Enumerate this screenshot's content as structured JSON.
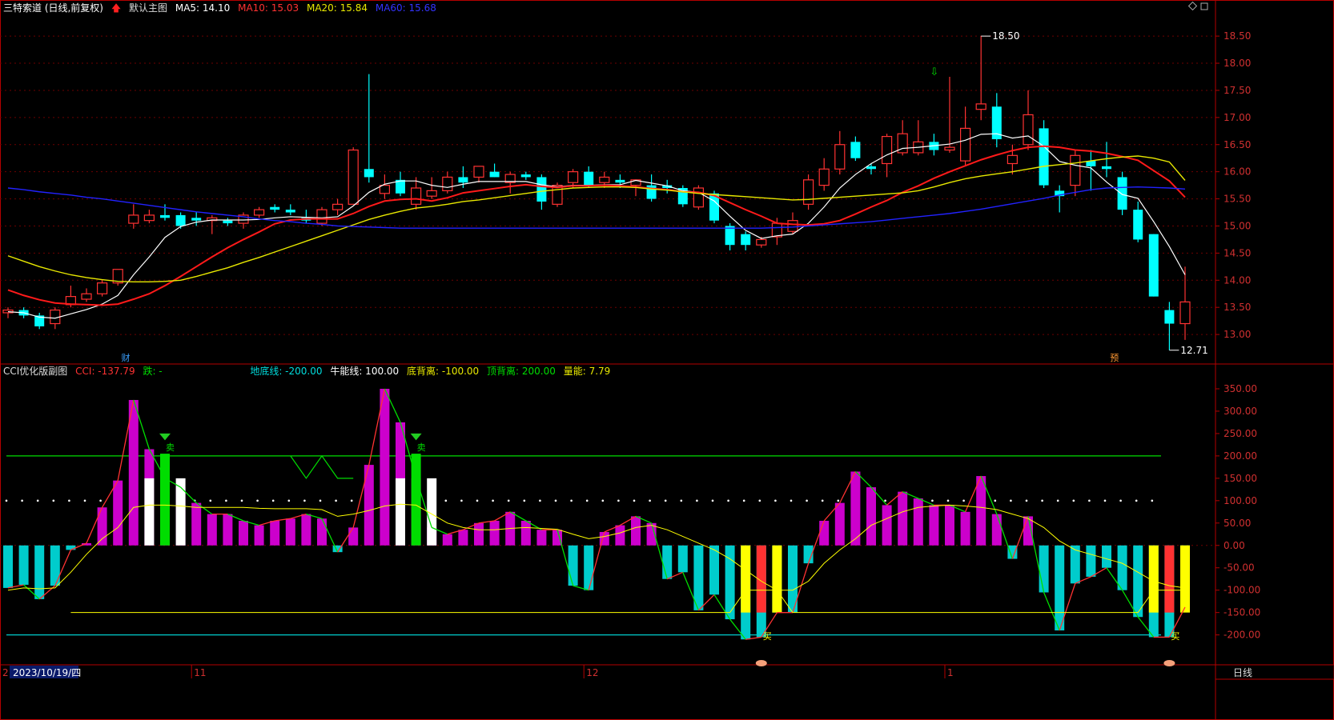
{
  "colors": {
    "up": "#ff3232",
    "down": "#00ffff",
    "ma5": "#ffffff",
    "ma10": "#ff1a1a",
    "ma20": "#e8e800",
    "ma60": "#2222ff",
    "axis": "#b40000",
    "grid": "#6e0000",
    "cci_pos": "#cc00cc",
    "cci_neg": "#00cccc",
    "green": "#00dd00",
    "yellow": "#ffff00",
    "white": "#ffffff"
  },
  "header_main": {
    "title": "三特索道 (日线,前复权)",
    "arrow_icon": "up-arrow-icon",
    "template": "默认主图",
    "ma5": "MA5: 14.10",
    "ma10": "MA10: 15.03",
    "ma20": "MA20: 15.84",
    "ma60": "MA60: 15.68"
  },
  "header_sub": {
    "title": "CCI优化版副图",
    "cci": "CCI: -137.79",
    "fall": "跌: -",
    "dd": "地底线: -200.00",
    "nn": "牛能线: 100.00",
    "dbl": "底背离: -100.00",
    "dgl": "顶背离: 200.00",
    "ln": "量能: 7.79"
  },
  "footer": {
    "date": "2023/10/19/四",
    "months": [
      {
        "label": "11",
        "i": 12
      },
      {
        "label": "12",
        "i": 37
      },
      {
        "label": "1",
        "i": 60
      },
      {
        "label": "2",
        "i": 84
      }
    ],
    "period_label": "日线"
  },
  "markers": {
    "cai": "财",
    "yu": "预",
    "sell": "卖",
    "buy": "买",
    "high_label": "18.50",
    "low_label": "12.71"
  },
  "chart_data": [
    {
      "type": "candlestick",
      "title": "三特索道 (日线,前复权)",
      "ylim": [
        12.5,
        18.9
      ],
      "y_ticks": [
        13.0,
        13.5,
        14.0,
        14.5,
        15.0,
        15.5,
        16.0,
        16.5,
        17.0,
        17.5,
        18.0,
        18.5
      ],
      "candles": [
        {
          "o": 13.4,
          "h": 13.5,
          "l": 13.3,
          "c": 13.45
        },
        {
          "o": 13.45,
          "h": 13.5,
          "l": 13.3,
          "c": 13.35
        },
        {
          "o": 13.35,
          "h": 13.4,
          "l": 13.1,
          "c": 13.15
        },
        {
          "o": 13.2,
          "h": 13.5,
          "l": 13.1,
          "c": 13.45
        },
        {
          "o": 13.55,
          "h": 13.9,
          "l": 13.5,
          "c": 13.7
        },
        {
          "o": 13.65,
          "h": 13.85,
          "l": 13.6,
          "c": 13.75
        },
        {
          "o": 13.75,
          "h": 14.0,
          "l": 13.7,
          "c": 13.95
        },
        {
          "o": 13.95,
          "h": 14.2,
          "l": 13.9,
          "c": 14.2
        },
        {
          "o": 15.05,
          "h": 15.4,
          "l": 14.95,
          "c": 15.2
        },
        {
          "o": 15.1,
          "h": 15.3,
          "l": 15.05,
          "c": 15.2
        },
        {
          "o": 15.2,
          "h": 15.4,
          "l": 15.1,
          "c": 15.15
        },
        {
          "o": 15.2,
          "h": 15.25,
          "l": 14.95,
          "c": 15.0
        },
        {
          "o": 15.15,
          "h": 15.25,
          "l": 15.0,
          "c": 15.1
        },
        {
          "o": 15.1,
          "h": 15.2,
          "l": 14.85,
          "c": 15.15
        },
        {
          "o": 15.1,
          "h": 15.15,
          "l": 15.0,
          "c": 15.05
        },
        {
          "o": 15.05,
          "h": 15.25,
          "l": 14.95,
          "c": 15.2
        },
        {
          "o": 15.2,
          "h": 15.35,
          "l": 15.15,
          "c": 15.3
        },
        {
          "o": 15.35,
          "h": 15.4,
          "l": 15.25,
          "c": 15.3
        },
        {
          "o": 15.3,
          "h": 15.4,
          "l": 15.2,
          "c": 15.25
        },
        {
          "o": 15.15,
          "h": 15.3,
          "l": 15.05,
          "c": 15.1
        },
        {
          "o": 15.05,
          "h": 15.35,
          "l": 15.0,
          "c": 15.3
        },
        {
          "o": 15.3,
          "h": 15.5,
          "l": 15.2,
          "c": 15.4
        },
        {
          "o": 15.4,
          "h": 16.45,
          "l": 15.4,
          "c": 16.4
        },
        {
          "o": 16.05,
          "h": 17.8,
          "l": 15.8,
          "c": 15.9
        },
        {
          "o": 15.6,
          "h": 15.95,
          "l": 15.5,
          "c": 15.75
        },
        {
          "o": 15.85,
          "h": 16.0,
          "l": 15.55,
          "c": 15.6
        },
        {
          "o": 15.4,
          "h": 15.9,
          "l": 15.3,
          "c": 15.7
        },
        {
          "o": 15.55,
          "h": 15.9,
          "l": 15.5,
          "c": 15.65
        },
        {
          "o": 15.65,
          "h": 16.0,
          "l": 15.6,
          "c": 15.9
        },
        {
          "o": 15.9,
          "h": 16.1,
          "l": 15.7,
          "c": 15.8
        },
        {
          "o": 15.9,
          "h": 16.1,
          "l": 15.8,
          "c": 16.1
        },
        {
          "o": 16.0,
          "h": 16.15,
          "l": 15.9,
          "c": 15.9
        },
        {
          "o": 15.8,
          "h": 16.0,
          "l": 15.6,
          "c": 15.95
        },
        {
          "o": 15.95,
          "h": 16.0,
          "l": 15.85,
          "c": 15.9
        },
        {
          "o": 15.9,
          "h": 15.95,
          "l": 15.3,
          "c": 15.45
        },
        {
          "o": 15.4,
          "h": 15.8,
          "l": 15.35,
          "c": 15.75
        },
        {
          "o": 15.8,
          "h": 16.05,
          "l": 15.7,
          "c": 16.0
        },
        {
          "o": 16.0,
          "h": 16.1,
          "l": 15.7,
          "c": 15.75
        },
        {
          "o": 15.8,
          "h": 16.0,
          "l": 15.7,
          "c": 15.9
        },
        {
          "o": 15.85,
          "h": 15.95,
          "l": 15.7,
          "c": 15.8
        },
        {
          "o": 15.75,
          "h": 15.85,
          "l": 15.55,
          "c": 15.85
        },
        {
          "o": 15.75,
          "h": 15.95,
          "l": 15.45,
          "c": 15.5
        },
        {
          "o": 15.75,
          "h": 15.85,
          "l": 15.6,
          "c": 15.7
        },
        {
          "o": 15.7,
          "h": 15.75,
          "l": 15.35,
          "c": 15.4
        },
        {
          "o": 15.35,
          "h": 15.75,
          "l": 15.3,
          "c": 15.7
        },
        {
          "o": 15.6,
          "h": 15.65,
          "l": 15.05,
          "c": 15.1
        },
        {
          "o": 15.0,
          "h": 15.05,
          "l": 14.55,
          "c": 14.65
        },
        {
          "o": 14.85,
          "h": 14.9,
          "l": 14.55,
          "c": 14.65
        },
        {
          "o": 14.65,
          "h": 14.8,
          "l": 14.6,
          "c": 14.75
        },
        {
          "o": 14.8,
          "h": 15.15,
          "l": 14.65,
          "c": 15.05
        },
        {
          "o": 14.9,
          "h": 15.25,
          "l": 14.85,
          "c": 15.1
        },
        {
          "o": 15.4,
          "h": 15.95,
          "l": 15.3,
          "c": 15.85
        },
        {
          "o": 15.75,
          "h": 16.25,
          "l": 15.65,
          "c": 16.05
        },
        {
          "o": 16.05,
          "h": 16.75,
          "l": 15.95,
          "c": 16.5
        },
        {
          "o": 16.55,
          "h": 16.65,
          "l": 16.2,
          "c": 16.25
        },
        {
          "o": 16.1,
          "h": 16.15,
          "l": 15.95,
          "c": 16.05
        },
        {
          "o": 16.15,
          "h": 16.7,
          "l": 15.9,
          "c": 16.65
        },
        {
          "o": 16.35,
          "h": 16.95,
          "l": 16.3,
          "c": 16.7
        },
        {
          "o": 16.35,
          "h": 16.95,
          "l": 16.3,
          "c": 16.55
        },
        {
          "o": 16.55,
          "h": 16.7,
          "l": 16.3,
          "c": 16.4
        },
        {
          "o": 16.4,
          "h": 17.75,
          "l": 16.35,
          "c": 16.45
        },
        {
          "o": 16.2,
          "h": 17.2,
          "l": 16.1,
          "c": 16.8
        },
        {
          "o": 17.15,
          "h": 18.5,
          "l": 16.95,
          "c": 17.25
        },
        {
          "o": 17.2,
          "h": 17.45,
          "l": 16.45,
          "c": 16.6
        },
        {
          "o": 16.15,
          "h": 16.5,
          "l": 15.95,
          "c": 16.3
        },
        {
          "o": 16.5,
          "h": 17.5,
          "l": 16.4,
          "c": 17.05
        },
        {
          "o": 16.8,
          "h": 16.95,
          "l": 15.7,
          "c": 15.75
        },
        {
          "o": 15.65,
          "h": 15.75,
          "l": 15.25,
          "c": 15.55
        },
        {
          "o": 15.75,
          "h": 16.4,
          "l": 15.55,
          "c": 16.3
        },
        {
          "o": 16.2,
          "h": 16.4,
          "l": 15.65,
          "c": 16.1
        },
        {
          "o": 16.1,
          "h": 16.55,
          "l": 15.9,
          "c": 16.05
        },
        {
          "o": 15.9,
          "h": 16.0,
          "l": 15.2,
          "c": 15.3
        },
        {
          "o": 15.3,
          "h": 15.45,
          "l": 14.7,
          "c": 14.75
        },
        {
          "o": 14.85,
          "h": 14.85,
          "l": 13.7,
          "c": 13.7
        },
        {
          "o": 13.45,
          "h": 13.6,
          "l": 12.71,
          "c": 13.2
        },
        {
          "o": 13.2,
          "h": 14.25,
          "l": 12.9,
          "c": 13.6
        }
      ],
      "series": [
        {
          "name": "MA5",
          "values": [
            13.42,
            13.4,
            13.32,
            13.3,
            13.38,
            13.46,
            13.56,
            13.72,
            14.1,
            14.43,
            14.79,
            14.99,
            15.07,
            15.11,
            15.11,
            15.11,
            15.12,
            15.15,
            15.17,
            15.16,
            15.15,
            15.17,
            15.37,
            15.62,
            15.77,
            15.83,
            15.83,
            15.75,
            15.71,
            15.77,
            15.82,
            15.82,
            15.82,
            15.82,
            15.76,
            15.72,
            15.75,
            15.75,
            15.76,
            15.76,
            15.84,
            15.79,
            15.74,
            15.65,
            15.62,
            15.46,
            15.18,
            14.92,
            14.77,
            14.82,
            14.85,
            15.05,
            15.35,
            15.7,
            15.95,
            16.15,
            16.31,
            16.43,
            16.45,
            16.48,
            16.51,
            16.58,
            16.69,
            16.7,
            16.62,
            16.66,
            16.47,
            16.19,
            16.12,
            16.07,
            15.81,
            15.58,
            15.51,
            15.08,
            14.62,
            14.1
          ]
        },
        {
          "name": "MA10",
          "values": [
            13.82,
            13.72,
            13.64,
            13.58,
            13.56,
            13.55,
            13.54,
            13.56,
            13.65,
            13.75,
            13.9,
            14.07,
            14.25,
            14.43,
            14.6,
            14.75,
            14.89,
            15.04,
            15.11,
            15.13,
            15.13,
            15.13,
            15.23,
            15.36,
            15.46,
            15.49,
            15.5,
            15.46,
            15.52,
            15.61,
            15.65,
            15.69,
            15.73,
            15.76,
            15.73,
            15.71,
            15.74,
            15.74,
            15.75,
            15.74,
            15.72,
            15.69,
            15.67,
            15.63,
            15.62,
            15.56,
            15.43,
            15.3,
            15.18,
            15.05,
            15.03,
            15.02,
            15.04,
            15.1,
            15.22,
            15.35,
            15.47,
            15.62,
            15.74,
            15.88,
            16.0,
            16.11,
            16.22,
            16.31,
            16.39,
            16.45,
            16.47,
            16.45,
            16.4,
            16.38,
            16.34,
            16.28,
            16.21,
            16.02,
            15.83,
            15.53
          ]
        },
        {
          "name": "MA20",
          "values": [
            14.45,
            14.35,
            14.25,
            14.17,
            14.1,
            14.05,
            14.01,
            13.98,
            13.97,
            13.97,
            13.98,
            14.0,
            14.07,
            14.15,
            14.23,
            14.33,
            14.42,
            14.52,
            14.62,
            14.72,
            14.82,
            14.92,
            15.02,
            15.12,
            15.2,
            15.27,
            15.33,
            15.36,
            15.4,
            15.45,
            15.48,
            15.52,
            15.56,
            15.6,
            15.64,
            15.67,
            15.7,
            15.71,
            15.72,
            15.72,
            15.71,
            15.68,
            15.66,
            15.63,
            15.6,
            15.58,
            15.56,
            15.54,
            15.52,
            15.5,
            15.48,
            15.49,
            15.51,
            15.53,
            15.55,
            15.57,
            15.59,
            15.61,
            15.65,
            15.72,
            15.8,
            15.87,
            15.92,
            15.96,
            16.0,
            16.05,
            16.1,
            16.13,
            16.16,
            16.2,
            16.24,
            16.27,
            16.29,
            16.25,
            16.18,
            15.84
          ]
        },
        {
          "name": "MA60",
          "values": [
            15.7,
            15.67,
            15.63,
            15.6,
            15.57,
            15.53,
            15.5,
            15.46,
            15.42,
            15.38,
            15.34,
            15.3,
            15.26,
            15.23,
            15.2,
            15.17,
            15.13,
            15.1,
            15.08,
            15.05,
            15.03,
            15.0,
            14.99,
            14.98,
            14.97,
            14.96,
            14.96,
            14.96,
            14.96,
            14.96,
            14.96,
            14.96,
            14.96,
            14.96,
            14.96,
            14.96,
            14.96,
            14.96,
            14.96,
            14.96,
            14.96,
            14.96,
            14.96,
            14.96,
            14.96,
            14.96,
            14.96,
            14.96,
            14.96,
            14.97,
            14.98,
            15.0,
            15.02,
            15.04,
            15.06,
            15.08,
            15.11,
            15.14,
            15.17,
            15.2,
            15.23,
            15.27,
            15.31,
            15.36,
            15.41,
            15.46,
            15.51,
            15.57,
            15.62,
            15.67,
            15.7,
            15.71,
            15.72,
            15.71,
            15.7,
            15.68
          ]
        }
      ],
      "annotations": [
        {
          "text": "18.50",
          "i": 62,
          "value": 18.5
        },
        {
          "text": "12.71",
          "i": 74,
          "value": 12.71
        }
      ]
    },
    {
      "type": "bar",
      "title": "CCI优化版副图",
      "ylim": [
        -265,
        375
      ],
      "y_ticks": [
        -200,
        -150,
        -100,
        -50,
        0,
        50,
        100,
        150,
        200,
        250,
        300,
        350
      ],
      "cci": [
        -95,
        -88,
        -120,
        -90,
        -10,
        5,
        85,
        145,
        325,
        215,
        150,
        130,
        95,
        70,
        70,
        55,
        45,
        55,
        60,
        70,
        60,
        -15,
        40,
        180,
        350,
        275,
        150,
        40,
        25,
        35,
        50,
        55,
        75,
        55,
        35,
        35,
        -90,
        -100,
        30,
        45,
        65,
        50,
        -75,
        -60,
        -145,
        -110,
        -165,
        -210,
        -205,
        -150,
        -150,
        -40,
        55,
        95,
        165,
        130,
        90,
        120,
        105,
        90,
        90,
        75,
        155,
        70,
        -30,
        65,
        -105,
        -190,
        -85,
        -70,
        -50,
        -100,
        -160,
        -205,
        -205,
        -138
      ],
      "ma": [
        -100,
        -95,
        -97,
        -95,
        -60,
        -20,
        15,
        40,
        85,
        90,
        90,
        88,
        85,
        85,
        85,
        85,
        83,
        82,
        82,
        82,
        80,
        65,
        70,
        78,
        88,
        92,
        90,
        70,
        50,
        40,
        35,
        35,
        38,
        40,
        38,
        36,
        25,
        15,
        20,
        28,
        40,
        45,
        35,
        20,
        5,
        -10,
        -30,
        -55,
        -80,
        -100,
        -100,
        -80,
        -40,
        -10,
        15,
        45,
        60,
        75,
        85,
        88,
        90,
        88,
        85,
        80,
        70,
        60,
        40,
        10,
        -10,
        -20,
        -30,
        -40,
        -60,
        -80,
        -90,
        -95
      ]
    }
  ]
}
